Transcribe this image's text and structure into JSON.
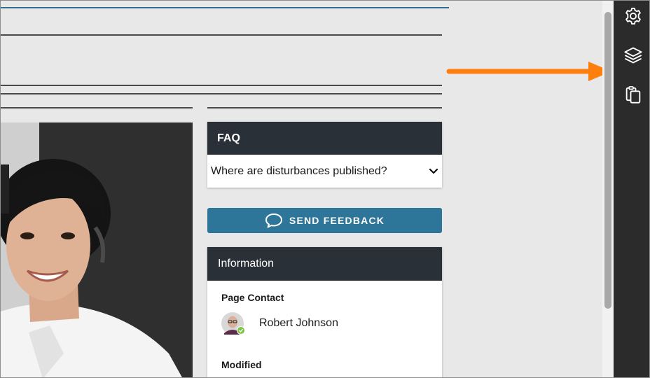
{
  "faq": {
    "title": "FAQ",
    "items": [
      {
        "question": "Where are disturbances published?"
      }
    ]
  },
  "feedback": {
    "label": "SEND FEEDBACK",
    "icon": "speech-bubble-icon"
  },
  "information": {
    "title": "Information",
    "page_contact_label": "Page Contact",
    "contact_name": "Robert Johnson",
    "contact_status": "online",
    "modified_label": "Modified"
  },
  "toolbar": {
    "icons": [
      "gear-icon",
      "layers-icon",
      "clipboard-icon"
    ]
  },
  "colors": {
    "header_bg": "#2a3037",
    "button_bg": "#2e7699",
    "toolbar_bg": "#2b2b2b",
    "arrow": "#ff7f0e",
    "status_ok": "#7cc243"
  }
}
